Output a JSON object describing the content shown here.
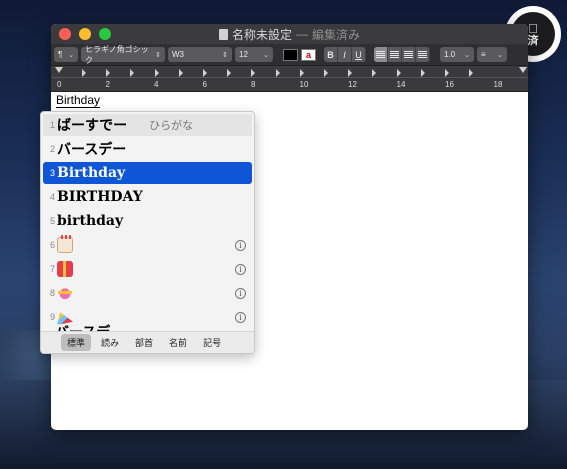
{
  "badge": {
    "text": "済"
  },
  "window": {
    "title": "名称未設定",
    "title_sep": "—",
    "title_status": "編集済み"
  },
  "toolbar": {
    "paragraph_style": "¶",
    "font_family": "ヒラギノ角ゴシック",
    "font_weight": "W3",
    "font_size": "12",
    "text_color": "#000000",
    "bold": "B",
    "italic": "I",
    "underline": "U",
    "line_spacing": "1.0",
    "list_style": "≡"
  },
  "ruler": {
    "labels": [
      "0",
      "2",
      "4",
      "6",
      "8",
      "10",
      "12",
      "14",
      "16",
      "18"
    ]
  },
  "document": {
    "typed_text": "Birthday"
  },
  "candidates": {
    "items": [
      {
        "num": "1",
        "text": "ばーすでー",
        "hint": "ひらがな"
      },
      {
        "num": "2",
        "text": "バースデー"
      },
      {
        "num": "3",
        "text": "Birthday",
        "selected": true
      },
      {
        "num": "4",
        "text": "BIRTHDAY"
      },
      {
        "num": "5",
        "text": "birthday"
      },
      {
        "num": "6",
        "emoji": "cake-emoji",
        "info": "i"
      },
      {
        "num": "7",
        "emoji": "gift-emoji",
        "info": "i"
      },
      {
        "num": "8",
        "emoji": "heart-ribbon-emoji",
        "info": "i"
      },
      {
        "num": "9",
        "emoji": "party-popper-emoji",
        "info": "i"
      }
    ],
    "clipped_text": "バースデ",
    "tabs": [
      "標準",
      "読み",
      "部首",
      "名前",
      "記号"
    ],
    "active_tab": "標準"
  },
  "colors": {
    "selection": "#0e56d6",
    "titlebar": "#3b3b3d"
  }
}
